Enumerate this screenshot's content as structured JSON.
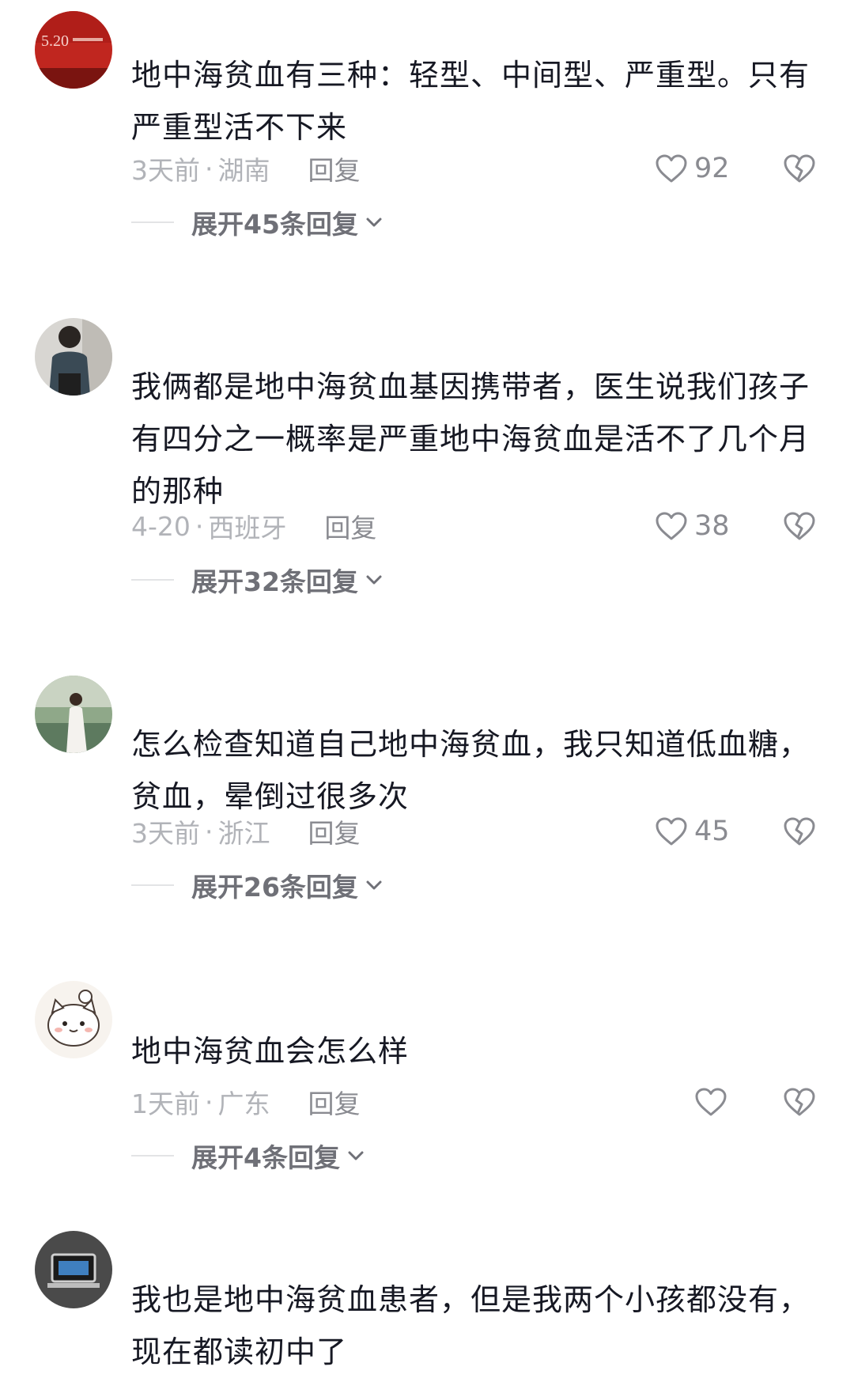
{
  "comments": [
    {
      "text": "地中海贫血有三种：轻型、中间型、严重型。只有严重型活不下来",
      "time": "3天前",
      "location": "湖南",
      "reply_label": "回复",
      "likes": "92",
      "expand_label": "展开45条回复",
      "avatar_text": "5.20"
    },
    {
      "text": "我俩都是地中海贫血基因携带者，医生说我们孩子有四分之一概率是严重地中海贫血是活不了几个月的那种",
      "time": "4-20",
      "location": "西班牙",
      "reply_label": "回复",
      "likes": "38",
      "expand_label": "展开32条回复"
    },
    {
      "text": "怎么检查知道自己地中海贫血，我只知道低血糖，贫血，晕倒过很多次",
      "time": "3天前",
      "location": "浙江",
      "reply_label": "回复",
      "likes": "45",
      "expand_label": "展开26条回复"
    },
    {
      "text": "地中海贫血会怎么样",
      "time": "1天前",
      "location": "广东",
      "reply_label": "回复",
      "likes": "",
      "expand_label": "展开4条回复"
    },
    {
      "text": "我也是地中海贫血患者，但是我两个小孩都没有，现在都读初中了",
      "time": "",
      "location": "",
      "reply_label": "",
      "likes": "",
      "expand_label": ""
    }
  ],
  "meta_separator": "·",
  "colors": {
    "text": "#161823",
    "meta": "#b1b3b8",
    "reply": "#8a8b91",
    "expand": "#6f7077"
  }
}
